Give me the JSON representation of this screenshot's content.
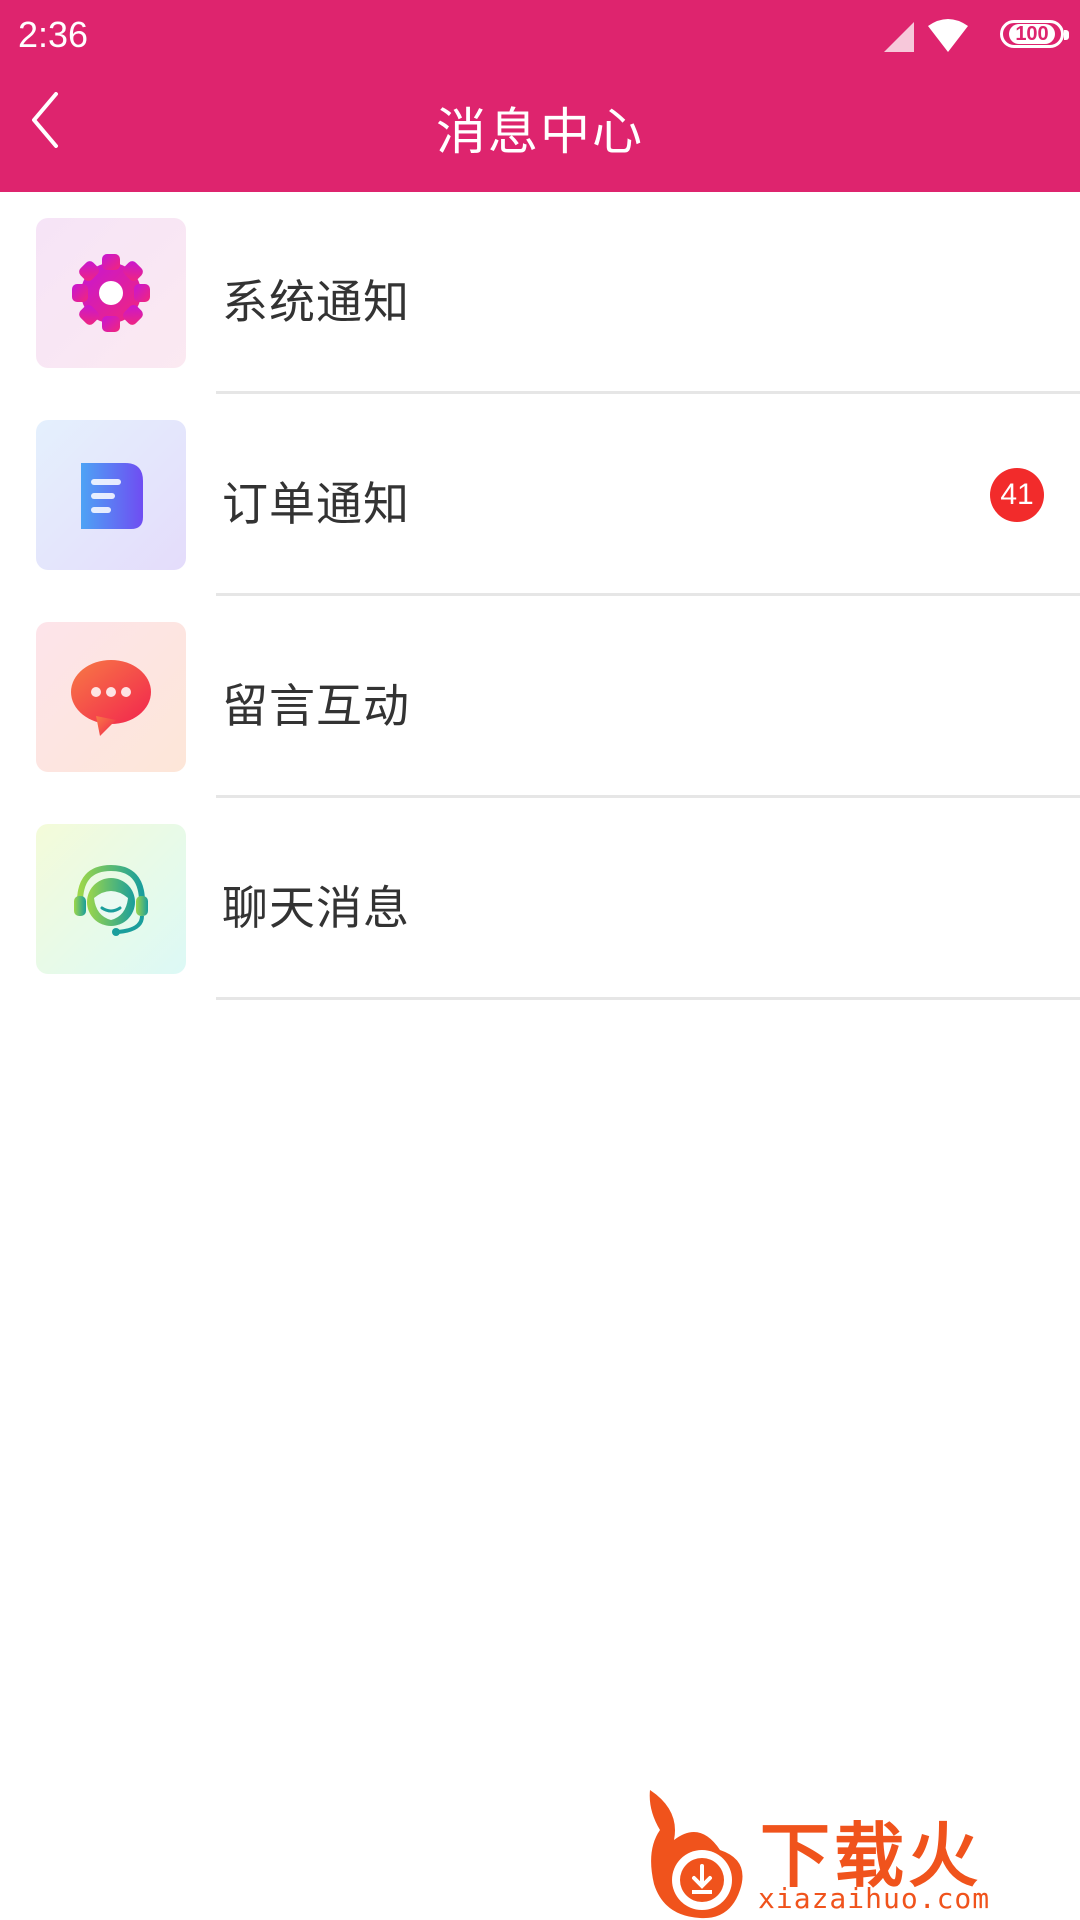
{
  "status_bar": {
    "time": "2:36",
    "battery": "100"
  },
  "header": {
    "title": "消息中心",
    "back_icon": "chevron-left-icon"
  },
  "colors": {
    "brand": "#DE246E",
    "badge": "#F22B2B",
    "text": "#333333"
  },
  "items": [
    {
      "label": "系统通知",
      "icon": "gear-icon"
    },
    {
      "label": "订单通知",
      "icon": "document-icon",
      "badge": "41"
    },
    {
      "label": "留言互动",
      "icon": "chat-bubble-icon"
    },
    {
      "label": "聊天消息",
      "icon": "headset-agent-icon"
    }
  ],
  "watermark": {
    "text": "下载火",
    "url": "xiazaihuo.com"
  }
}
